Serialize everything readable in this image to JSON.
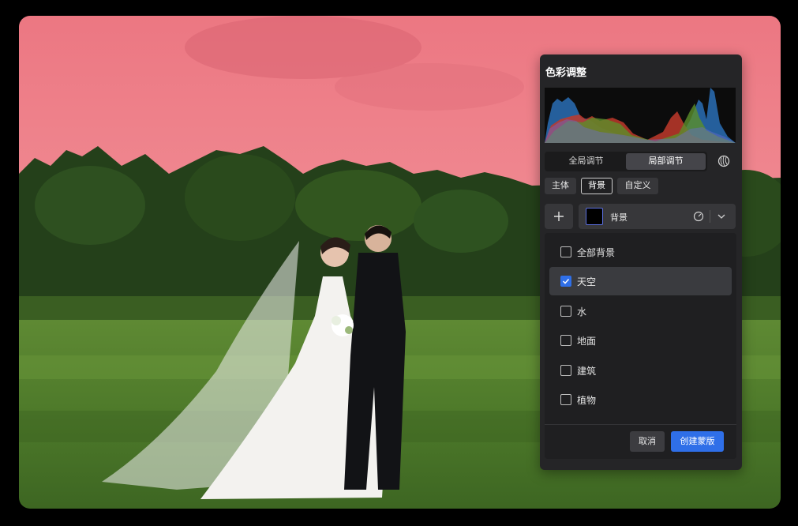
{
  "panel": {
    "title": "色彩调整",
    "segments": {
      "global": "全局调节",
      "local": "局部调节",
      "active": "局部调节"
    },
    "chips": [
      "主体",
      "背景",
      "自定义"
    ],
    "active_chip": "背景",
    "add_label": "+",
    "mask": {
      "label": "背景",
      "swatch_color": "#000000"
    },
    "options": [
      {
        "label": "全部背景",
        "checked": false
      },
      {
        "label": "天空",
        "checked": true
      },
      {
        "label": "水",
        "checked": false
      },
      {
        "label": "地面",
        "checked": false
      },
      {
        "label": "建筑",
        "checked": false
      },
      {
        "label": "植物",
        "checked": false
      }
    ],
    "buttons": {
      "cancel": "取消",
      "create": "创建蒙版"
    }
  },
  "colors": {
    "sky_mask": "#ef7b86",
    "accent": "#2f6fe8",
    "panel_bg": "#252527"
  },
  "icons": [
    "plus-icon",
    "gauge-icon",
    "chevron-down-icon",
    "checkmark-icon",
    "color-wheel-icon"
  ]
}
